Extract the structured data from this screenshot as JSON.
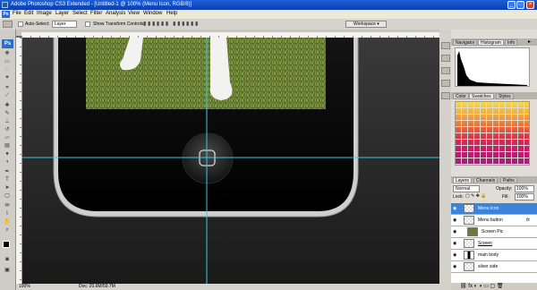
{
  "app": {
    "title": "Adobe Photoshop CS3 Extended - [Untitled-1 @ 100% (Menu Icon, RGB/8)]",
    "logo_text": "Ps",
    "window_controls": [
      "_",
      "□",
      "×"
    ]
  },
  "menu": [
    "File",
    "Edit",
    "Image",
    "Layer",
    "Select",
    "Filter",
    "Analysis",
    "View",
    "Window",
    "Help"
  ],
  "options": {
    "auto_select_label": "Auto-Select:",
    "auto_select_value": "Layer",
    "transform_label": "Show Transform Controls",
    "workspace_label": "Workspace"
  },
  "status": {
    "zoom": "100%",
    "doc": "Doc: 20.6M/59.7M"
  },
  "navigator": {
    "tabs": [
      "Navigator",
      "Histogram",
      "Info"
    ],
    "active": 1
  },
  "swatches": {
    "tabs": [
      "Color",
      "Swatches",
      "Styles"
    ],
    "active": 1
  },
  "layers": {
    "tabs": [
      "Layers",
      "Channels",
      "Paths"
    ],
    "blend_mode": "Normal",
    "opacity_label": "Opacity:",
    "opacity_value": "100%",
    "lock_label": "Lock:",
    "fill_label": "Fill:",
    "fill_value": "100%",
    "items": [
      {
        "name": "Menu Icon",
        "selected": true
      },
      {
        "name": "Menu button",
        "selected": false,
        "fx": "fx"
      },
      {
        "name": "Screen Pic",
        "selected": false
      },
      {
        "name": "Screen",
        "selected": false
      },
      {
        "name": "main body",
        "selected": false
      },
      {
        "name": "silver side",
        "selected": false
      }
    ]
  },
  "colors": {
    "accent": "#3c83d9",
    "guide": "#3ec8e8"
  }
}
